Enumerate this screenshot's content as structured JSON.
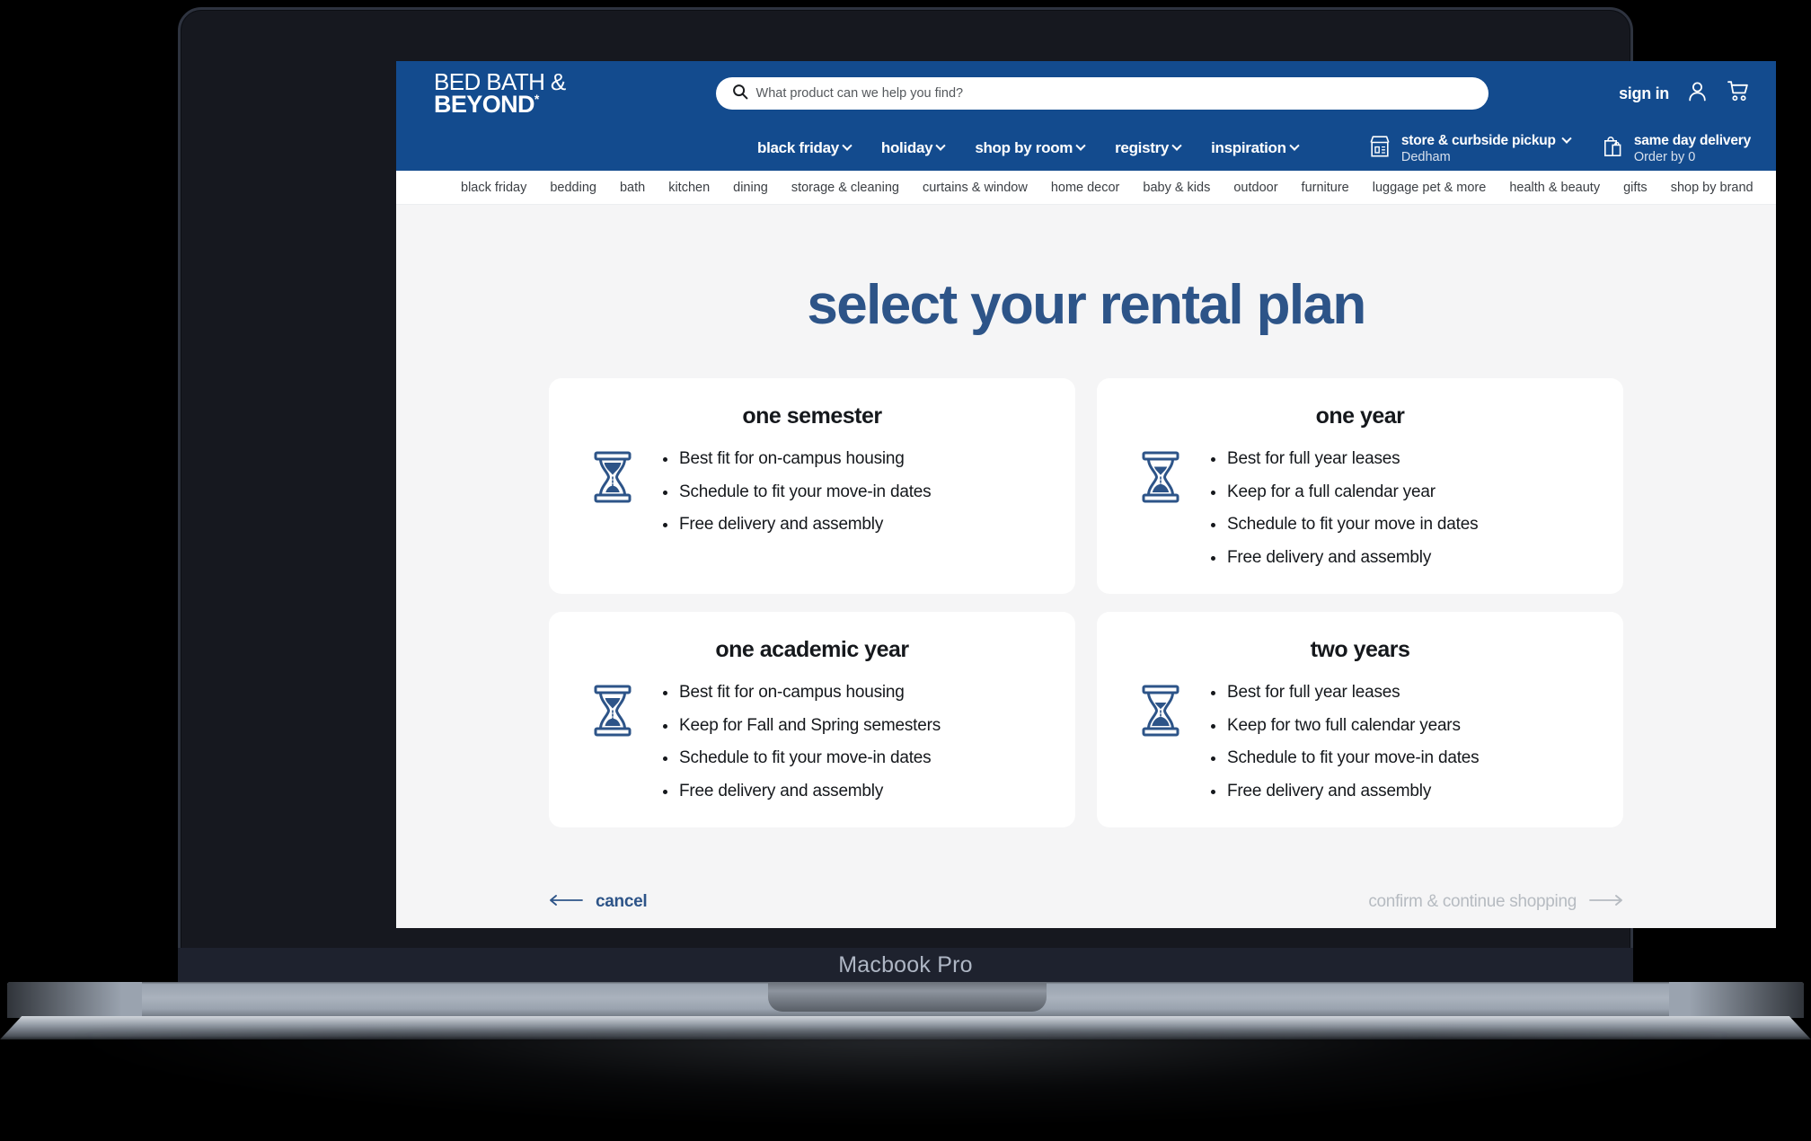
{
  "device": {
    "label": "Macbook Pro"
  },
  "colors": {
    "brand_blue": "#134b8e",
    "title_blue": "#2d5488",
    "icon_blue": "#2d5488",
    "page_bg": "#f5f5f6",
    "card_bg": "#ffffff",
    "disabled_gray": "#b6bbc1"
  },
  "header": {
    "logo": {
      "line1": "BED BATH &",
      "line2": "BEYOND",
      "mark": "*"
    },
    "search": {
      "placeholder": "What product can we help you find?",
      "value": "",
      "icon": "search-icon"
    },
    "sign_in_label": "sign in",
    "account_icon": "user-icon",
    "cart_icon": "shopping-cart-icon",
    "nav_items": [
      {
        "label": "black friday",
        "has_dropdown": true
      },
      {
        "label": "holiday",
        "has_dropdown": true
      },
      {
        "label": "shop by room",
        "has_dropdown": true
      },
      {
        "label": "registry",
        "has_dropdown": true
      },
      {
        "label": "inspiration",
        "has_dropdown": true
      }
    ],
    "services": [
      {
        "icon": "store-icon",
        "title": "store & curbside pickup",
        "subtitle": "Dedham",
        "has_dropdown": true
      },
      {
        "icon": "delivery-bag-icon",
        "title": "same day delivery",
        "subtitle": "Order by 0",
        "has_dropdown": false
      }
    ]
  },
  "category_bar": {
    "links": [
      "black friday",
      "bedding",
      "bath",
      "kitchen",
      "dining",
      "storage & cleaning",
      "curtains & window",
      "home decor",
      "baby & kids",
      "outdoor",
      "furniture",
      "luggage pet & more",
      "health & beauty",
      "gifts",
      "shop by brand"
    ]
  },
  "main": {
    "page_title": "select your rental plan",
    "plans": [
      {
        "title": "one semester",
        "icon": "hourglass-icon",
        "features": [
          "Best fit for on-campus housing",
          "Schedule to fit your move-in dates",
          "Free delivery and assembly"
        ]
      },
      {
        "title": "one year",
        "icon": "hourglass-icon",
        "features": [
          "Best for full year leases",
          "Keep for a full calendar year",
          "Schedule to fit your move in dates",
          "Free delivery and assembly"
        ]
      },
      {
        "title": "one academic year",
        "icon": "hourglass-icon",
        "features": [
          "Best fit for on-campus housing",
          "Keep for Fall and Spring semesters",
          "Schedule to fit your move-in dates",
          "Free delivery and assembly"
        ]
      },
      {
        "title": "two years",
        "icon": "hourglass-icon",
        "features": [
          "Best for full year leases",
          "Keep for two full calendar years",
          "Schedule to fit your move-in dates",
          "Free delivery and assembly"
        ]
      }
    ]
  },
  "footer": {
    "cancel_label": "cancel",
    "cancel_icon": "arrow-left-icon",
    "confirm_label": "confirm & continue shopping",
    "confirm_icon": "arrow-right-icon",
    "confirm_disabled": true
  }
}
